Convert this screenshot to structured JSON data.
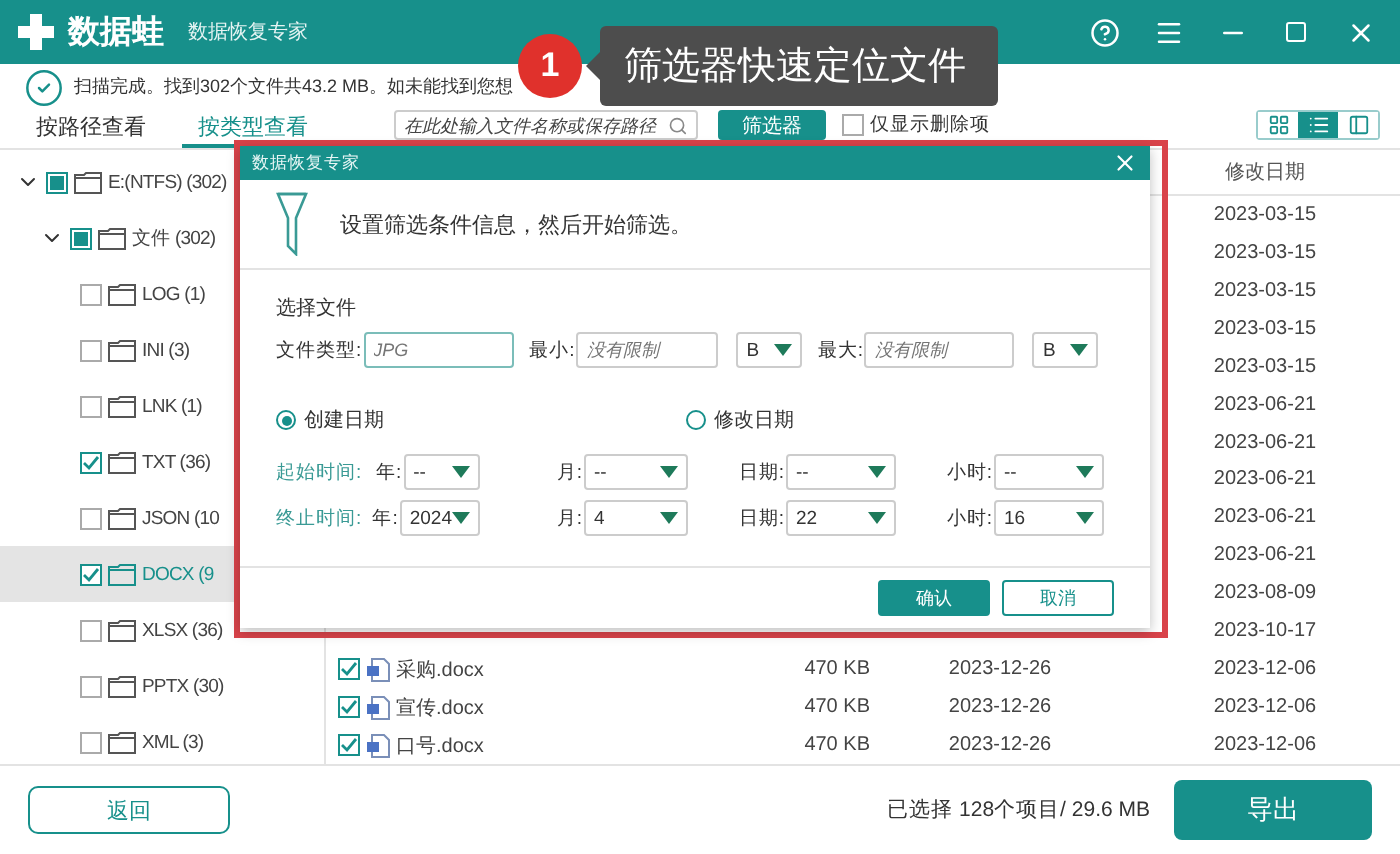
{
  "app": {
    "brand": "数据蛙",
    "subtitle": "数据恢复专家"
  },
  "status": {
    "message": "扫描完成。找到302个文件共43.2 MB。如未能找到您想"
  },
  "callout": {
    "number": "1",
    "text": "筛选器快速定位文件"
  },
  "tabs": [
    {
      "label": "按路径查看",
      "selected": false
    },
    {
      "label": "按类型查看",
      "selected": true
    }
  ],
  "search": {
    "placeholder": "在此处输入文件名称或保存路径"
  },
  "filter_button": "筛选器",
  "deleted_only": {
    "label": "仅显示删除项",
    "checked": false
  },
  "view_modes": [
    {
      "kind": "grid",
      "selected": false
    },
    {
      "kind": "list",
      "selected": true
    },
    {
      "kind": "columns",
      "selected": false
    }
  ],
  "tree": [
    {
      "label": "E:(NTFS) (302)",
      "checked": false,
      "partial": true,
      "expanded": true,
      "selected": false,
      "children": [
        {
          "label": "文件 (302)",
          "checked": false,
          "partial": true,
          "expanded": true,
          "selected": false,
          "children": [
            {
              "label": "LOG (1)",
              "checked": false,
              "selected": false
            },
            {
              "label": "INI (3)",
              "checked": false,
              "selected": false
            },
            {
              "label": "LNK (1)",
              "checked": false,
              "selected": false
            },
            {
              "label": "TXT (36)",
              "checked": true,
              "selected": false
            },
            {
              "label": "JSON (10",
              "checked": false,
              "selected": false
            },
            {
              "label": "DOCX (9",
              "checked": true,
              "selected": true
            },
            {
              "label": "XLSX (36)",
              "checked": false,
              "selected": false
            },
            {
              "label": "PPTX (30)",
              "checked": false,
              "selected": false
            },
            {
              "label": "XML (3)",
              "checked": false,
              "selected": false
            }
          ]
        }
      ]
    }
  ],
  "table": {
    "columns": [
      {
        "label": "修改日期"
      }
    ],
    "rows": [
      {
        "modified": "2023-03-15"
      },
      {
        "modified": "2023-03-15"
      },
      {
        "modified": "2023-03-15"
      },
      {
        "modified": "2023-03-15"
      },
      {
        "modified": "2023-03-15"
      },
      {
        "modified": "2023-06-21"
      },
      {
        "modified": "2023-06-21"
      },
      {
        "modified": "2023-06-21"
      },
      {
        "modified": "2023-06-21"
      },
      {
        "modified": "2023-06-21"
      },
      {
        "modified": "2023-08-09"
      },
      {
        "modified": "2023-10-17"
      },
      {
        "checked": true,
        "name": "采购.docx",
        "size": "470 KB",
        "created": "2023-12-26",
        "modified": "2023-12-06"
      },
      {
        "checked": true,
        "name": "宣传.docx",
        "size": "470 KB",
        "created": "2023-12-26",
        "modified": "2023-12-06"
      },
      {
        "checked": true,
        "name": "口号.docx",
        "size": "470 KB",
        "created": "2023-12-26",
        "modified": "2023-12-06"
      }
    ]
  },
  "footer": {
    "back": "返回",
    "selection": "已选择 128个项目/ 29.6 MB",
    "export": "导出"
  },
  "dialog": {
    "title": "数据恢复专家",
    "intro": "设置筛选条件信息，然后开始筛选。",
    "section": "选择文件",
    "file_type": {
      "label": "文件类型:",
      "placeholder": "JPG"
    },
    "min": {
      "label": "最小:",
      "placeholder": "没有限制",
      "unit": "B"
    },
    "max": {
      "label": "最大:",
      "placeholder": "没有限制",
      "unit": "B"
    },
    "date_modes": [
      {
        "label": "创建日期",
        "selected": true
      },
      {
        "label": "修改日期",
        "selected": false
      }
    ],
    "time_rows": [
      {
        "label": "起始时间:",
        "fields": [
          {
            "label": "年:",
            "value": "--"
          },
          {
            "label": "月:",
            "value": "--"
          },
          {
            "label": "日期:",
            "value": "--"
          },
          {
            "label": "小时:",
            "value": "--"
          }
        ]
      },
      {
        "label": "终止时间:",
        "fields": [
          {
            "label": "年:",
            "value": "2024"
          },
          {
            "label": "月:",
            "value": "4"
          },
          {
            "label": "日期:",
            "value": "22"
          },
          {
            "label": "小时:",
            "value": "16"
          }
        ]
      }
    ],
    "buttons": [
      {
        "label": "确认",
        "kind": "primary"
      },
      {
        "label": "取消",
        "kind": "secondary"
      }
    ]
  }
}
